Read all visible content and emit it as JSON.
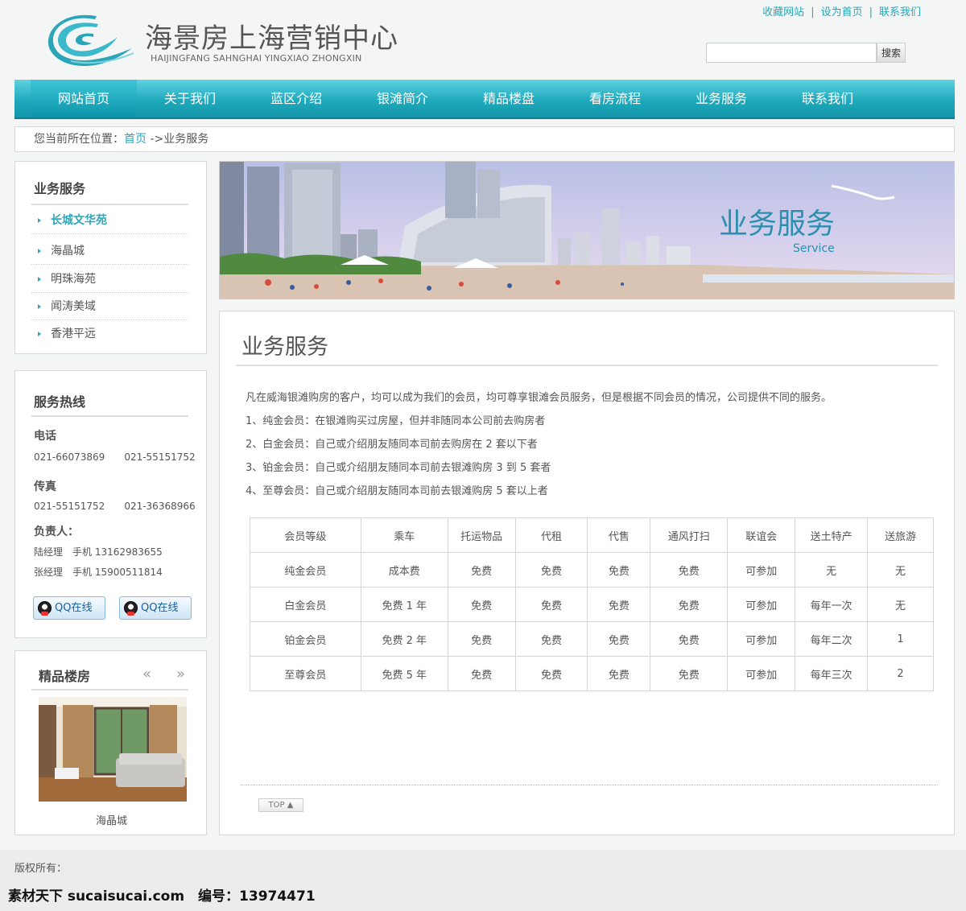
{
  "header": {
    "title": "海景房上海营销中心",
    "pinyin": "HAIJINGFANG SAHNGHAI YINGXIAO ZHONGXIN",
    "top_links": [
      "收藏网站",
      "设为首页",
      "联系我们"
    ],
    "search": {
      "placeholder": "",
      "button_label": "搜索"
    }
  },
  "nav": [
    "网站首页",
    "关于我们",
    "蓝区介绍",
    "银滩简介",
    "精品楼盘",
    "看房流程",
    "业务服务",
    "联系我们"
  ],
  "breadcrumb": {
    "prefix": "您当前所在位置：",
    "home": "首页",
    "current": " ->业务服务"
  },
  "sidebar": {
    "menu_title": "业务服务",
    "menu_items": [
      "长城文华苑",
      "海晶城",
      "明珠海苑",
      "闻涛美域",
      "香港平远"
    ],
    "hotline": {
      "title": "服务热线",
      "phone_label": "电话",
      "phones": "021-66073869　　021-55151752",
      "fax_label": "传真",
      "faxes": "021-55151752　　021-36368966",
      "contact_label": "负责人：",
      "contacts": [
        "陆经理　手机 13162983655",
        "张经理　手机 15900511814"
      ],
      "qq_label": "QQ在线"
    },
    "featured": {
      "title": "精品楼房",
      "prev": "«",
      "next": "»",
      "caption": "海晶城"
    }
  },
  "banner": {
    "title": "业务服务",
    "subtitle": "Service"
  },
  "main": {
    "title": "业务服务",
    "intro": [
      "凡在威海银滩购房的客户，均可以成为我们的会员，均可尊享银滩会员服务，但是根据不同会员的情况，公司提供不同的服务。",
      "1、纯金会员：在银滩购买过房屋，但并非随同本公司前去购房者",
      "2、白金会员：自己或介绍朋友随同本司前去购房在 2 套以下者",
      "3、铂金会员：自己或介绍朋友随同本司前去银滩购房 3 到 5 套者",
      "4、至尊会员：自己或介绍朋友随同本司前去银滩购房 5 套以上者"
    ],
    "table": {
      "headers": [
        "会员等级",
        "乘车",
        "托运物品",
        "代租",
        "代售",
        "通风打扫",
        "联谊会",
        "送土特产",
        "送旅游"
      ],
      "rows": [
        [
          "纯金会员",
          "成本费",
          "免费",
          "免费",
          "免费",
          "免费",
          "可参加",
          "无",
          "无"
        ],
        [
          "白金会员",
          "免费 1 年",
          "免费",
          "免费",
          "免费",
          "免费",
          "可参加",
          "每年一次",
          "无"
        ],
        [
          "铂金会员",
          "免费 2 年",
          "免费",
          "免费",
          "免费",
          "免费",
          "可参加",
          "每年二次",
          "1"
        ],
        [
          "至尊会员",
          "免费 5 年",
          "免费",
          "免费",
          "免费",
          "免费",
          "可参加",
          "每年三次",
          "2"
        ]
      ]
    },
    "top_button": "TOP ▲"
  },
  "footer": {
    "copyright": "版权所有：",
    "watermark": "素材天下 sucaisucai.com　编号：13974471"
  },
  "colors": {
    "accent": "#2aa6b8",
    "nav_bg": "#1ea9bc"
  }
}
